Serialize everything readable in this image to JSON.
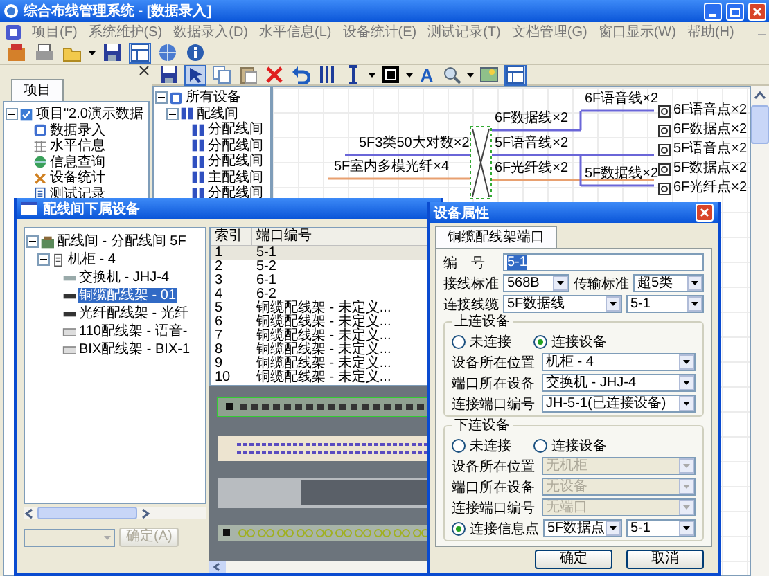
{
  "window": {
    "title": "综合布线管理系统 - [数据录入]"
  },
  "menu": [
    "项目(F)",
    "系统维护(S)",
    "数据录入(D)",
    "水平信息(L)",
    "设备统计(E)",
    "测试记录(T)",
    "文档管理(G)",
    "窗口显示(W)",
    "帮助(H)"
  ],
  "toolbar_font_button": "A",
  "project_panel": {
    "tab": {
      "label": "项目",
      "selected": true
    },
    "tree": [
      {
        "label": "项目\"2.0演示数据",
        "expanded": true,
        "children": [
          {
            "label": "数据录入"
          },
          {
            "label": "水平信息"
          },
          {
            "label": "信息查询"
          },
          {
            "label": "设备统计"
          },
          {
            "label": "测试记录"
          }
        ]
      }
    ]
  },
  "device_tree": [
    {
      "label": "所有设备",
      "expanded": true,
      "children": [
        {
          "label": "配线间",
          "expanded": true,
          "children": [
            {
              "label": "分配线间"
            },
            {
              "label": "分配线间"
            },
            {
              "label": "分配线间"
            },
            {
              "label": "主配线间"
            },
            {
              "label": "分配线间"
            }
          ]
        }
      ]
    }
  ],
  "diagram": {
    "links": [
      {
        "label": "5F3类50大对数×2",
        "kind": "copper"
      },
      {
        "label": "5F室内多模光纤×4",
        "kind": "fiber"
      },
      {
        "label": "6F数据线×2",
        "kind": "copper"
      },
      {
        "label": "5F语音线×2",
        "kind": "copper"
      },
      {
        "label": "6F光纤线×2",
        "kind": "fiber"
      },
      {
        "label": "6F语音线×2",
        "kind": "copper"
      },
      {
        "label": "5F数据线×2",
        "kind": "copper"
      }
    ],
    "outlets": [
      "6F语音点×2",
      "6F数据点×2",
      "5F语音点×2",
      "5F数据点×2",
      "6F光纤点×2"
    ]
  },
  "rack_dialog": {
    "title": "配线间下属设备",
    "tree": [
      {
        "label": "配线间 - 分配线间 5F",
        "expanded": true,
        "selected": false,
        "kind": "room",
        "children": [
          {
            "label": "机柜 - 4",
            "expanded": true,
            "selected": false,
            "kind": "cabinet",
            "children": [
              {
                "label": "交换机 - JHJ-4",
                "selected": false,
                "kind": "switch"
              },
              {
                "label": "铜缆配线架 - 01",
                "selected": true,
                "kind": "panel"
              },
              {
                "label": "光纤配线架 - 光纤",
                "selected": false,
                "kind": "panel"
              },
              {
                "label": "110配线架 - 语音-",
                "selected": false,
                "kind": "block"
              },
              {
                "label": "BIX配线架 - BIX-1",
                "selected": false,
                "kind": "block"
              }
            ]
          }
        ]
      }
    ],
    "table": {
      "columns": [
        "索引",
        "端口编号"
      ],
      "rows": [
        {
          "cells": [
            "1",
            "5-1"
          ],
          "selected": true
        },
        {
          "cells": [
            "2",
            "5-2"
          ],
          "selected": false
        },
        {
          "cells": [
            "3",
            "6-1"
          ],
          "selected": false
        },
        {
          "cells": [
            "4",
            "6-2"
          ],
          "selected": false
        },
        {
          "cells": [
            "5",
            "铜缆配线架 - 未定义..."
          ],
          "selected": false
        },
        {
          "cells": [
            "6",
            "铜缆配线架 - 未定义..."
          ],
          "selected": false
        },
        {
          "cells": [
            "7",
            "铜缆配线架 - 未定义..."
          ],
          "selected": false
        },
        {
          "cells": [
            "8",
            "铜缆配线架 - 未定义..."
          ],
          "selected": false
        },
        {
          "cells": [
            "9",
            "铜缆配线架 - 未定义..."
          ],
          "selected": false
        },
        {
          "cells": [
            "10",
            "铜缆配线架 - 未定义..."
          ],
          "selected": false
        }
      ]
    },
    "confirm_button": {
      "label": "确定(A)",
      "disabled": true
    }
  },
  "property_dialog": {
    "title": "设备属性",
    "tab": {
      "label": "铜缆配线架端口",
      "selected": true
    },
    "number": {
      "label": "编　号",
      "value": "5-1",
      "value_selected": true
    },
    "standards": [
      {
        "label": "接线标准",
        "value": "568B"
      },
      {
        "label": "传输标准",
        "value": "超5类"
      }
    ],
    "cable": {
      "label": "连接线缆",
      "value": "5F数据线",
      "value2": "5-1"
    },
    "groups": [
      {
        "title": "上连设备",
        "options": [
          {
            "label": "未连接",
            "selected": false
          },
          {
            "label": "连接设备",
            "selected": true
          }
        ],
        "fields": [
          {
            "label": "设备所在位置",
            "value": "机柜 - 4",
            "disabled": false
          },
          {
            "label": "端口所在设备",
            "value": "交换机 - JHJ-4",
            "disabled": false
          },
          {
            "label": "连接端口编号",
            "value": "JH-5-1(已连接设备)",
            "disabled": false
          }
        ]
      },
      {
        "title": "下连设备",
        "options": [
          {
            "label": "未连接",
            "selected": false
          },
          {
            "label": "连接设备",
            "selected": false
          }
        ],
        "fields": [
          {
            "label": "设备所在位置",
            "value": "无机柜",
            "disabled": true
          },
          {
            "label": "端口所在设备",
            "value": "无设备",
            "disabled": true
          },
          {
            "label": "连接端口编号",
            "value": "无端口",
            "disabled": true
          }
        ],
        "outlet": {
          "label": "连接信息点",
          "selected": true,
          "value": "5F数据点",
          "value2": "5-1"
        }
      }
    ],
    "buttons": [
      "确定",
      "取消"
    ]
  }
}
